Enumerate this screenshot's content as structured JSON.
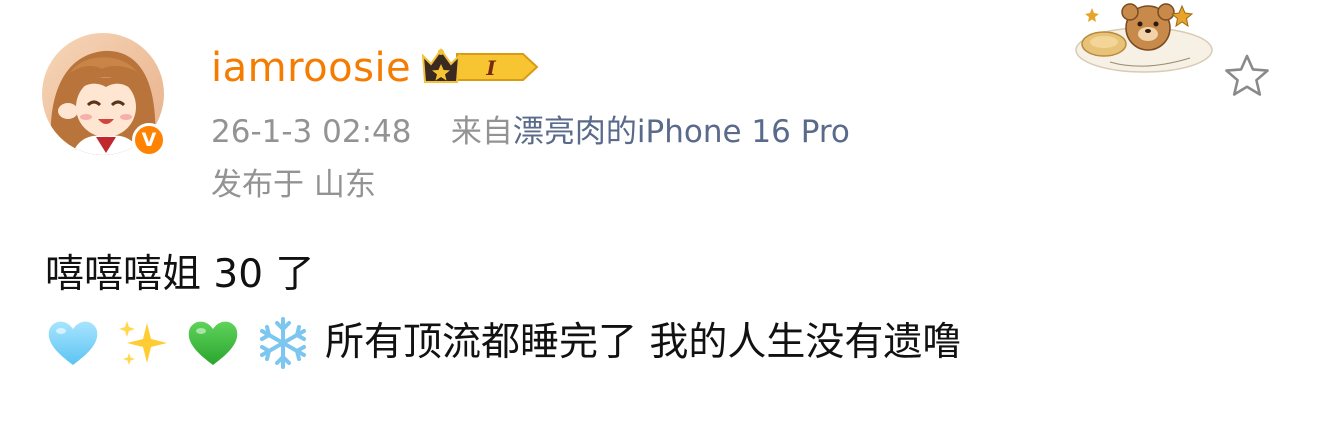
{
  "post": {
    "author": {
      "username": "iamroosie",
      "verified_badge": "V",
      "vip_level": "I"
    },
    "meta": {
      "datetime": "26-1-3 02:48",
      "source_prefix": "来自",
      "source_device": "漂亮肉的iPhone 16 Pro",
      "location": "发布于 山东"
    },
    "content": {
      "line1": "嘻嘻嘻姐 30 了",
      "emojis": [
        "light-blue-heart",
        "sparkles",
        "green-heart",
        "snowflake"
      ],
      "line2_text": "所有顶流都睡完了 我的人生没有遗噜"
    },
    "icons": {
      "favorite": "star-outline-icon",
      "card_sticker": "teddy-bear-sticker"
    },
    "colors": {
      "username": "#f57c00",
      "meta_text": "#939393",
      "source_link": "#5a6a8a",
      "content_text": "#111111",
      "verified_badge": "#ff8200"
    }
  }
}
